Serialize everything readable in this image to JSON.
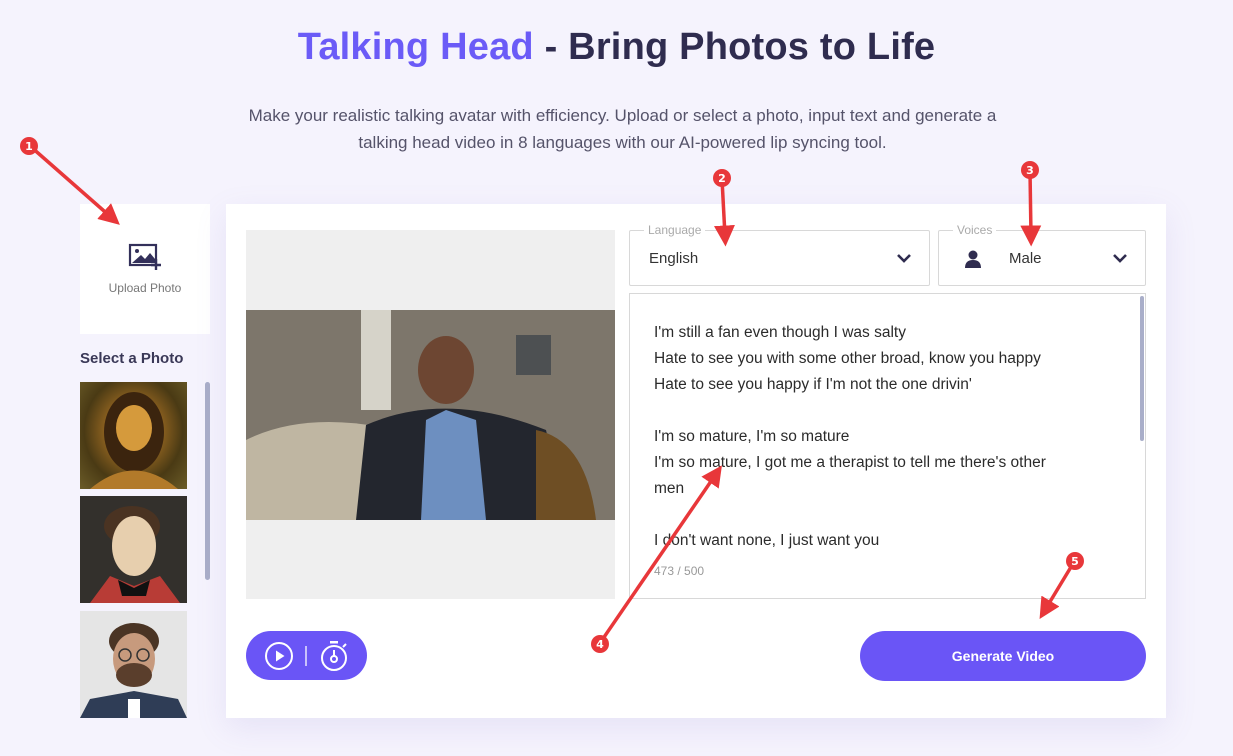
{
  "header": {
    "title_accent": "Talking Head",
    "title_rest": " - Bring Photos to Life",
    "subtitle_line1": "Make your realistic talking avatar with efficiency. Upload or select a photo, input text and generate a",
    "subtitle_line2": "talking head video in 8 languages with our AI-powered lip syncing tool."
  },
  "sidebar": {
    "upload_label": "Upload Photo",
    "select_title": "Select a Photo",
    "photos": [
      {
        "name": "Mona Lisa portrait"
      },
      {
        "name": "Napoleon portrait"
      },
      {
        "name": "Man with glasses"
      }
    ]
  },
  "editor": {
    "language": {
      "label": "Language",
      "value": "English"
    },
    "voices": {
      "label": "Voices",
      "value": "Male"
    },
    "text_lines": "I'm still a fan even though I was salty\nHate to see you with some other broad, know you happy\nHate to see you happy if I'm not the one drivin'\n\nI'm so mature, I'm so mature\nI'm so mature, I got me a therapist to tell me there's other\nmen\n\nI don't want none, I just want you",
    "char_count": "473 / 500",
    "generate_label": "Generate Video"
  },
  "annotations": [
    "1",
    "2",
    "3",
    "4",
    "5"
  ],
  "colors": {
    "accent": "#6a55f6",
    "annotation": "#e8373a"
  }
}
